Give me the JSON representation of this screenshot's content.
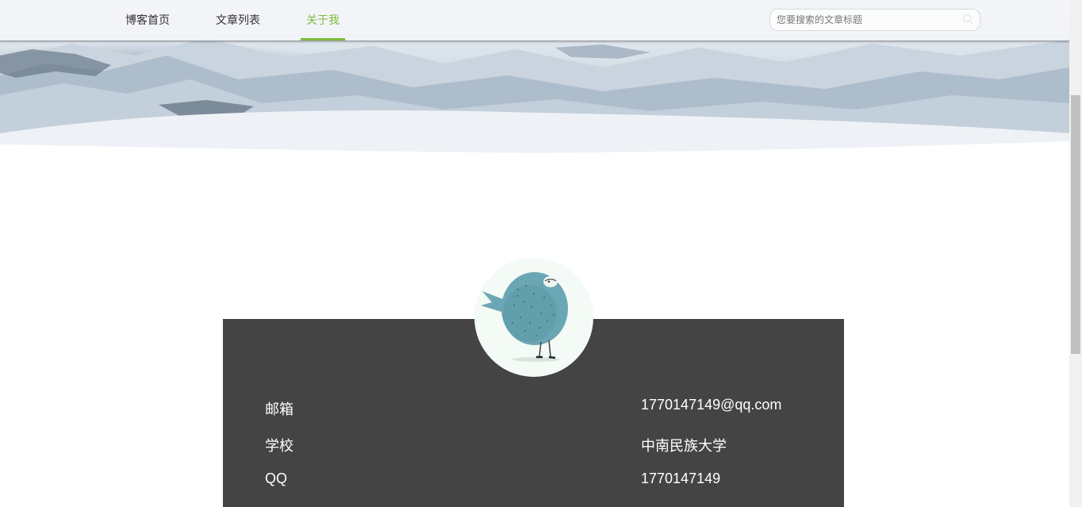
{
  "nav": {
    "items": [
      {
        "label": "博客首页",
        "active": false
      },
      {
        "label": "文章列表",
        "active": false
      },
      {
        "label": "关于我",
        "active": true
      }
    ],
    "accent_color": "#7fba3b"
  },
  "search": {
    "placeholder": "您要搜索的文章标题",
    "icon": "search-icon"
  },
  "profile": {
    "avatar_icon": "bird-illustration",
    "rows": [
      {
        "label": "邮箱",
        "value": "1770147149@qq.com"
      },
      {
        "label": "学校",
        "value": "中南民族大学"
      },
      {
        "label": "QQ",
        "value": "1770147149"
      }
    ],
    "card_color": "#444444"
  }
}
